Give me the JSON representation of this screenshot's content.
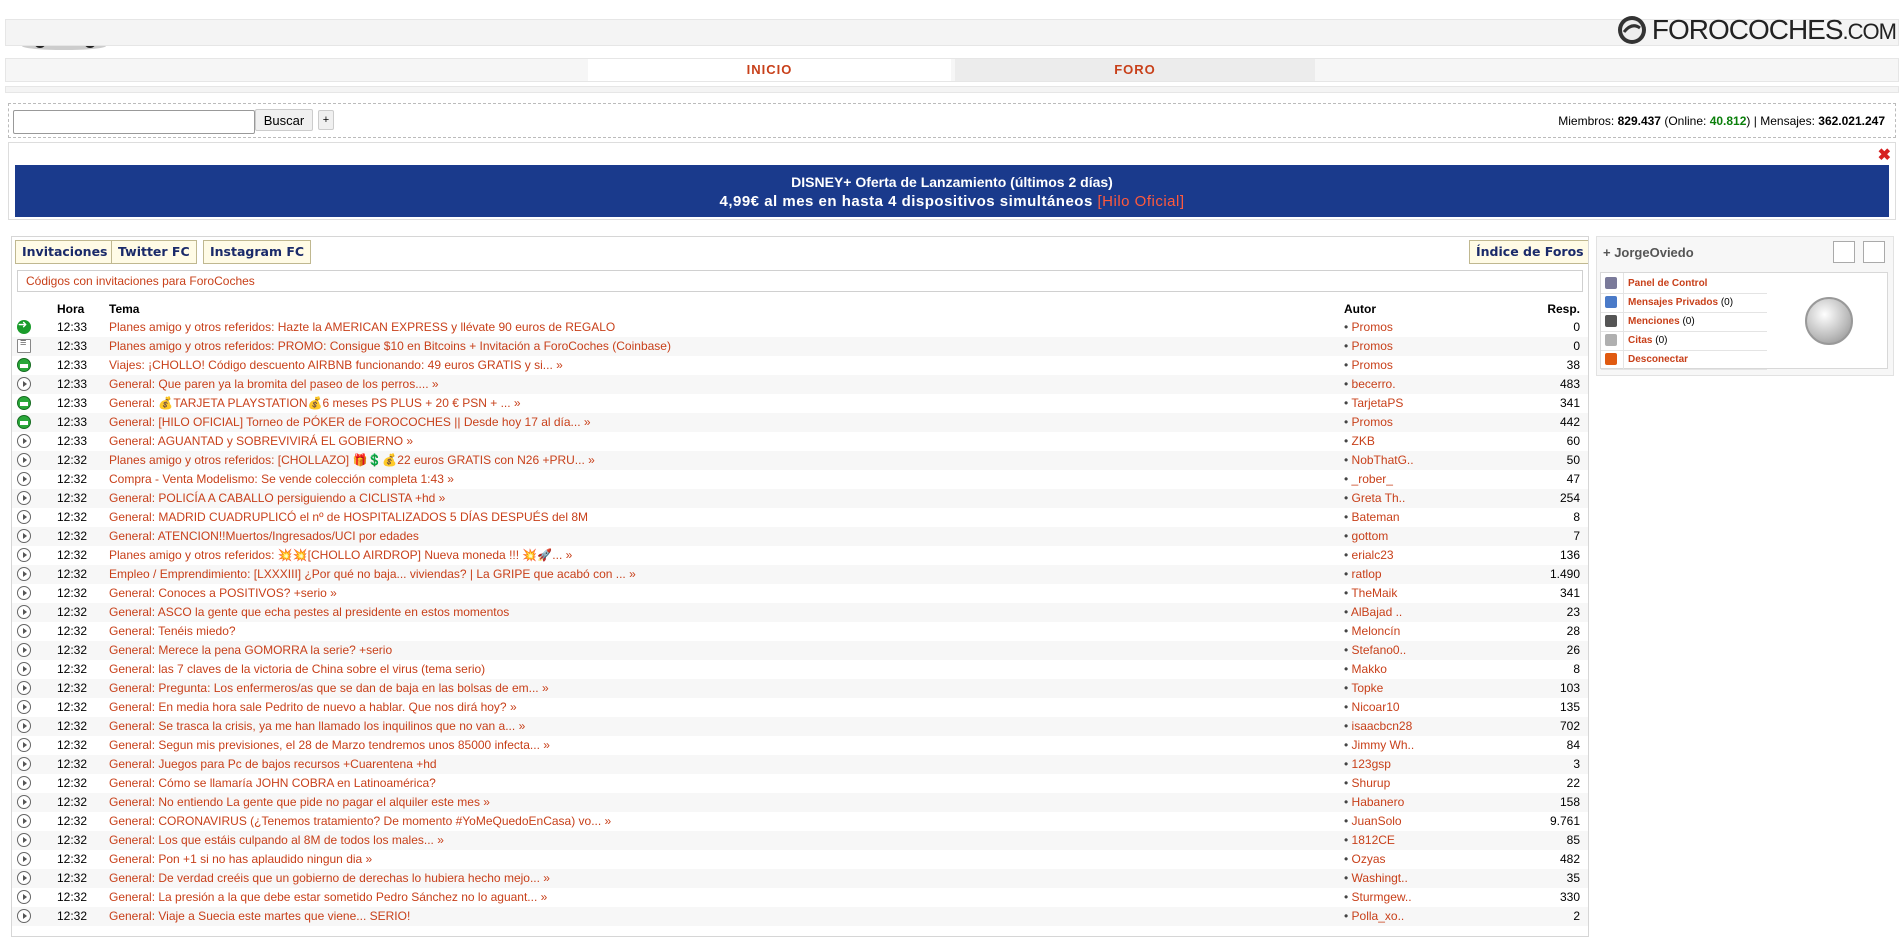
{
  "brand": {
    "name": "FOROCOCHES",
    "tld": ".COM"
  },
  "nav": {
    "inicio": "INICIO",
    "foro": "FORO"
  },
  "search": {
    "value": "",
    "button": "Buscar",
    "advanced": "+"
  },
  "stats": {
    "members_label": "Miembros:",
    "members": "829.437",
    "online_label": "(Online:",
    "online": "40.812",
    "online_close": ")",
    "sep": "|",
    "messages_label": "Mensajes:",
    "messages": "362.021.247"
  },
  "banner": {
    "line1": "DISNEY+ Oferta de Lanzamiento (últimos 2 días)",
    "line2": "4,99€ al mes en hasta 4 dispositivos simultáneos",
    "link": "[Hilo Oficial]",
    "close": "✖"
  },
  "tabs": {
    "invitaciones": "Invitaciones",
    "twitter": "Twitter FC",
    "instagram": "Instagram FC",
    "indice": "Índice de Foros"
  },
  "promo_text": "Códigos con invitaciones para ForoCoches",
  "table": {
    "headers": {
      "hora": "Hora",
      "tema": "Tema",
      "autor": "Autor",
      "resp": "Resp."
    },
    "rows": [
      {
        "icon": "arrow",
        "hora": "12:33",
        "cat": "Planes amigo y otros referidos:",
        "tit": "Hazte la AMERICAN EXPRESS y llévate 90 euros de REGALO",
        "autor": "Promos",
        "resp": "0"
      },
      {
        "icon": "doc",
        "hora": "12:33",
        "cat": "Planes amigo y otros referidos:",
        "tit": "PROMO: Consigue $10 en Bitcoins + Invitación a ForoCoches (Coinbase)",
        "autor": "Promos",
        "resp": "0"
      },
      {
        "icon": "globe",
        "hora": "12:33",
        "cat": "Viajes:",
        "tit": "¡CHOLLO! Código descuento AIRBNB funcionando: 49 euros GRATIS y si... »",
        "autor": "Promos",
        "resp": "38"
      },
      {
        "icon": "play",
        "hora": "12:33",
        "cat": "General:",
        "tit": "Que paren ya la bromita del paseo de los perros.... »",
        "autor": "becerro.",
        "resp": "483"
      },
      {
        "icon": "globe",
        "hora": "12:33",
        "cat": "General:",
        "tit": "💰TARJETA PLAYSTATION💰6 meses PS PLUS + 20 € PSN + ... »",
        "autor": "TarjetaPS",
        "resp": "341"
      },
      {
        "icon": "globe",
        "hora": "12:33",
        "cat": "General:",
        "tit": "[HILO OFICIAL] Torneo de PÓKER de FOROCOCHES || Desde hoy 17 al día... »",
        "autor": "Promos",
        "resp": "442"
      },
      {
        "icon": "play",
        "hora": "12:33",
        "cat": "General:",
        "tit": "AGUANTAD y SOBREVIVIRÁ EL GOBIERNO »",
        "autor": "ZKB",
        "resp": "60"
      },
      {
        "icon": "play",
        "hora": "12:32",
        "cat": "Planes amigo y otros referidos:",
        "tit": "[CHOLLAZO] 🎁💲💰22 euros GRATIS con N26 +PRU... »",
        "autor": "NobThatG..",
        "resp": "50"
      },
      {
        "icon": "play",
        "hora": "12:32",
        "cat": "Compra - Venta Modelismo:",
        "tit": "Se vende colección completa 1:43 »",
        "autor": "_rober_",
        "resp": "47"
      },
      {
        "icon": "play",
        "hora": "12:32",
        "cat": "General:",
        "tit": "POLICÍA A CABALLO persiguiendo a CICLISTA +hd »",
        "autor": "Greta Th..",
        "resp": "254"
      },
      {
        "icon": "play",
        "hora": "12:32",
        "cat": "General:",
        "tit": "MADRID CUADRUPLICÓ el nº de HOSPITALIZADOS 5 DÍAS DESPUÉS del 8M",
        "autor": "Bateman",
        "resp": "8"
      },
      {
        "icon": "play",
        "hora": "12:32",
        "cat": "General:",
        "tit": "ATENCION!!Muertos/Ingresados/UCI por edades",
        "autor": "gottom",
        "resp": "7"
      },
      {
        "icon": "play",
        "hora": "12:32",
        "cat": "Planes amigo y otros referidos:",
        "tit": "💥💥[CHOLLO AIRDROP] Nueva moneda !!! 💥🚀... »",
        "autor": "erialc23",
        "resp": "136"
      },
      {
        "icon": "play",
        "hora": "12:32",
        "cat": "Empleo / Emprendimiento:",
        "tit": "[LXXXIII] ¿Por qué no baja... viviendas? | La GRIPE que acabó con ... »",
        "autor": "ratlop",
        "resp": "1.490"
      },
      {
        "icon": "play",
        "hora": "12:32",
        "cat": "General:",
        "tit": "Conoces a POSITIVOS? +serio »",
        "autor": "TheMaik",
        "resp": "341"
      },
      {
        "icon": "play",
        "hora": "12:32",
        "cat": "General:",
        "tit": "ASCO la gente que echa pestes al presidente en estos momentos",
        "autor": "AlBajad ..",
        "resp": "23"
      },
      {
        "icon": "play",
        "hora": "12:32",
        "cat": "General:",
        "tit": "Tenéis miedo?",
        "autor": "Meloncín",
        "resp": "28"
      },
      {
        "icon": "play",
        "hora": "12:32",
        "cat": "General:",
        "tit": "Merece la pena GOMORRA la serie? +serio",
        "autor": "Stefano0..",
        "resp": "26"
      },
      {
        "icon": "play",
        "hora": "12:32",
        "cat": "General:",
        "tit": "las 7 claves de la victoria de China sobre el virus (tema serio)",
        "autor": "Makko",
        "resp": "8"
      },
      {
        "icon": "play",
        "hora": "12:32",
        "cat": "General:",
        "tit": "Pregunta: Los enfermeros/as que se dan de baja en las bolsas de em... »",
        "autor": "Topke",
        "resp": "103"
      },
      {
        "icon": "play",
        "hora": "12:32",
        "cat": "General:",
        "tit": "En media hora sale Pedrito de nuevo a hablar. Que nos dirá hoy? »",
        "autor": "Nicoar10",
        "resp": "135"
      },
      {
        "icon": "play",
        "hora": "12:32",
        "cat": "General:",
        "tit": "Se trasca la crisis, ya me han llamado los inquilinos que no van a... »",
        "autor": "isaacbcn28",
        "resp": "702"
      },
      {
        "icon": "play",
        "hora": "12:32",
        "cat": "General:",
        "tit": "Segun mis previsiones, el 28 de Marzo tendremos unos 85000 infecta... »",
        "autor": "Jimmy Wh..",
        "resp": "84"
      },
      {
        "icon": "play",
        "hora": "12:32",
        "cat": "General:",
        "tit": "Juegos para Pc de bajos recursos +Cuarentena +hd",
        "autor": "123gsp",
        "resp": "3"
      },
      {
        "icon": "play",
        "hora": "12:32",
        "cat": "General:",
        "tit": "Cómo se llamaría JOHN COBRA en Latinoamérica?",
        "autor": "Shurup",
        "resp": "22"
      },
      {
        "icon": "play",
        "hora": "12:32",
        "cat": "General:",
        "tit": "No entiendo La gente que pide no pagar el alquiler este mes »",
        "autor": "Habanero",
        "resp": "158"
      },
      {
        "icon": "play",
        "hora": "12:32",
        "cat": "General:",
        "tit": "CORONAVIRUS (¿Tenemos tratamiento? De momento #YoMeQuedoEnCasa) vo... »",
        "autor": "JuanSolo",
        "resp": "9.761"
      },
      {
        "icon": "play",
        "hora": "12:32",
        "cat": "General:",
        "tit": "Los que estáis culpando al 8M de todos los males... »",
        "autor": "1812CE",
        "resp": "85"
      },
      {
        "icon": "play",
        "hora": "12:32",
        "cat": "General:",
        "tit": "Pon +1 si no has aplaudido ningun dia »",
        "autor": "Ozyas",
        "resp": "482"
      },
      {
        "icon": "play",
        "hora": "12:32",
        "cat": "General:",
        "tit": "De verdad creéis que un gobierno de derechas lo hubiera hecho mejo... »",
        "autor": "Washingt..",
        "resp": "35"
      },
      {
        "icon": "play",
        "hora": "12:32",
        "cat": "General:",
        "tit": "La presión a la que debe estar sometido Pedro Sánchez no lo aguant... »",
        "autor": "Sturmgew..",
        "resp": "330"
      },
      {
        "icon": "play",
        "hora": "12:32",
        "cat": "General:",
        "tit": "Viaje a Suecia este martes que viene... SERIO!",
        "autor": "Polla_xo..",
        "resp": "2"
      }
    ]
  },
  "user": {
    "name": "+ JorgeOviedo",
    "menu": [
      {
        "label": "Panel de Control",
        "count": "",
        "color": "#7a7a9a"
      },
      {
        "label": "Mensajes Privados",
        "count": "(0)",
        "color": "#4a7ac8"
      },
      {
        "label": "Menciones",
        "count": "(0)",
        "color": "#555555"
      },
      {
        "label": "Citas",
        "count": "(0)",
        "color": "#b0b0b0"
      },
      {
        "label": "Desconectar",
        "count": "",
        "color": "#e05a10"
      }
    ]
  }
}
